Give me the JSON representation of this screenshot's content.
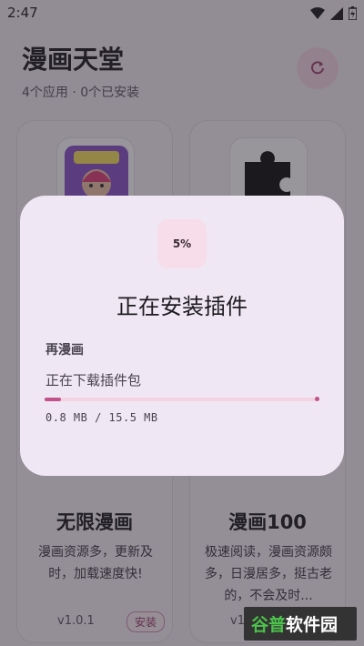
{
  "status_bar": {
    "time": "2:47"
  },
  "header": {
    "title": "漫画天堂",
    "subtitle": "4个应用 · 0个已安装"
  },
  "apps": [
    {
      "name": "无限漫画",
      "desc": "漫画资源多，更新及时，加载速度快!",
      "version": "v1.0.1",
      "action": "安装"
    },
    {
      "name": "漫画100",
      "desc": "极速阅读，漫画资源颇多，日漫居多，挺古老的，不会及时...",
      "version": "v1"
    }
  ],
  "dialog": {
    "percent_label": "5%",
    "progress": 0.05,
    "title": "正在安装插件",
    "plugin_name": "再漫画",
    "status": "正在下载插件包",
    "size": "0.8 MB / 15.5 MB"
  },
  "watermark": {
    "brand": "谷普软件园"
  },
  "colors": {
    "accent": "#c2538a",
    "dialog_bg": "#efe7f3"
  }
}
